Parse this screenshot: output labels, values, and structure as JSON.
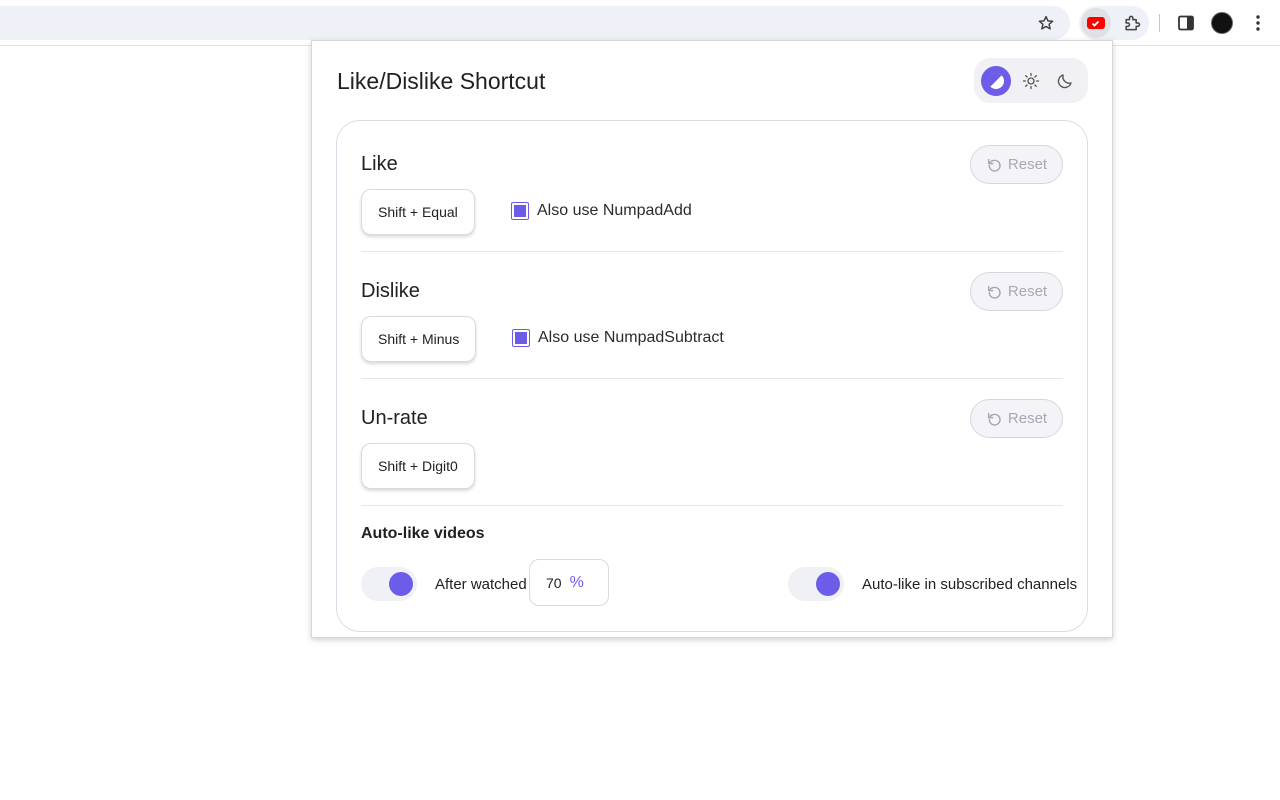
{
  "browser": {
    "icons": [
      "star-icon",
      "youtube-extension-icon",
      "puzzle-icon",
      "side-panel-icon",
      "avatar",
      "more-vert-icon"
    ]
  },
  "popup": {
    "title": "Like/Dislike Shortcut",
    "theme_options": [
      "auto-theme-icon",
      "sun-icon",
      "moon-icon"
    ],
    "sections": {
      "like": {
        "title": "Like",
        "shortcut": "Shift + Equal",
        "reset_label": "Reset",
        "alt_label": "Also use NumpadAdd",
        "alt_checked": true
      },
      "dislike": {
        "title": "Dislike",
        "shortcut": "Shift + Minus",
        "reset_label": "Reset",
        "alt_label": "Also use NumpadSubtract",
        "alt_checked": true
      },
      "unrate": {
        "title": "Un-rate",
        "shortcut": "Shift + Digit0",
        "reset_label": "Reset"
      }
    },
    "auto_like": {
      "title": "Auto-like videos",
      "after_watched_label": "After watched",
      "after_watched_enabled": true,
      "percent_value": "70",
      "percent_unit": "%",
      "subscribed_label": "Auto-like in subscribed channels",
      "subscribed_enabled": true
    }
  },
  "colors": {
    "accent": "#6c5ce7",
    "youtube_red": "#ff0000"
  }
}
